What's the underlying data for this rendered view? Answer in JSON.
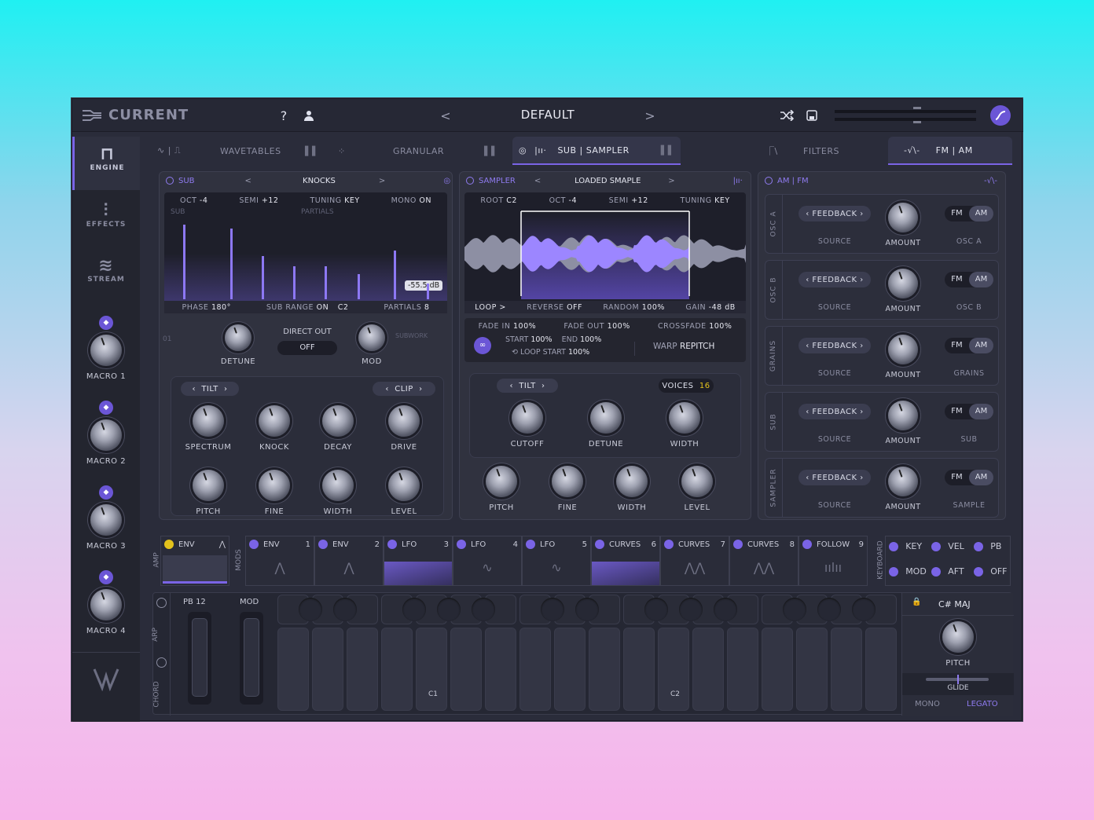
{
  "app": {
    "name": "CURRENT",
    "preset": "DEFAULT"
  },
  "sidebar": {
    "items": [
      {
        "label": "ENGINE"
      },
      {
        "label": "EFFECTS"
      },
      {
        "label": "STREAM"
      }
    ],
    "macros": [
      "MACRO 1",
      "MACRO 2",
      "MACRO 3",
      "MACRO 4"
    ]
  },
  "tabs": {
    "wavetables": "WAVETABLES",
    "granular": "GRANULAR",
    "sub_sampler": "SUB | SAMPLER",
    "filters": "FILTERS",
    "fm_am": "FM | AM"
  },
  "sub": {
    "title": "SUB",
    "preset": "KNOCKS",
    "top": {
      "oct_label": "OCT",
      "oct": "-4",
      "semi_label": "SEMI",
      "semi": "+12",
      "tuning_label": "TUNING",
      "tuning": "KEY",
      "mono_label": "MONO",
      "mono": "ON"
    },
    "viz_sub": "SUB",
    "viz_partials": "PARTIALS",
    "db": "-55.5 dB",
    "bottom": {
      "phase_label": "PHASE",
      "phase": "180°",
      "range_label": "SUB RANGE",
      "range": "ON",
      "range_note": "C2",
      "partials_label": "PARTIALS",
      "partials": "8"
    },
    "slot": "01",
    "subwork": "SUBWORK",
    "direct_out": "DIRECT OUT",
    "direct_out_val": "OFF",
    "knob_detune": "DETUNE",
    "knob_mod": "MOD",
    "tilt": "TILT",
    "clip": "CLIP",
    "row1": [
      "SPECTRUM",
      "KNOCK",
      "DECAY",
      "DRIVE"
    ],
    "row2": [
      "PITCH",
      "FINE",
      "WIDTH",
      "LEVEL"
    ],
    "partial_levels": [
      0.95,
      0.9,
      0.55,
      0.42,
      0.42,
      0.32,
      0.62,
      0.2
    ]
  },
  "sampler": {
    "title": "SAMPLER",
    "preset": "LOADED SMAPLE",
    "top": {
      "root_label": "ROOT",
      "root": "C2",
      "oct_label": "OCT",
      "oct": "-4",
      "semi_label": "SEMI",
      "semi": "+12",
      "tuning_label": "TUNING",
      "tuning": "KEY"
    },
    "bottom": {
      "loop": "LOOP >",
      "reverse_label": "REVERSE",
      "reverse": "OFF",
      "random_label": "RANDOM",
      "random": "100%",
      "gain_label": "GAIN",
      "gain": "-48 dB"
    },
    "fade_in_label": "FADE IN",
    "fade_in": "100%",
    "fade_out_label": "FADE OUT",
    "fade_out": "100%",
    "crossfade_label": "CROSSFADE",
    "crossfade": "100%",
    "start_label": "START",
    "start": "100%",
    "end_label": "END",
    "end": "100%",
    "loop_start_label": "LOOP START",
    "loop_start": "100%",
    "warp_label": "WARP",
    "warp": "REPITCH",
    "tilt": "TILT",
    "voices_label": "VOICES",
    "voices": "16",
    "row1": [
      "CUTOFF",
      "DETUNE",
      "WIDTH"
    ],
    "row2": [
      "PITCH",
      "FINE",
      "WIDTH",
      "LEVEL"
    ]
  },
  "fm": {
    "title": "AM | FM",
    "rows": [
      {
        "label": "OSC A",
        "target": "OSC A"
      },
      {
        "label": "OSC B",
        "target": "OSC B"
      },
      {
        "label": "GRAINS",
        "target": "GRAINS"
      },
      {
        "label": "SUB",
        "target": "SUB"
      },
      {
        "label": "SAMPLER",
        "target": "SAMPLE"
      }
    ],
    "feedback": "FEEDBACK",
    "source": "SOURCE",
    "amount": "AMOUNT",
    "fm": "FM",
    "am": "AM"
  },
  "mods": {
    "amp": "AMP",
    "mods_label": "MODS",
    "keyboard": "KEYBOARD",
    "slots": [
      {
        "name": "ENV",
        "num": ""
      },
      {
        "name": "ENV",
        "num": "1"
      },
      {
        "name": "ENV",
        "num": "2"
      },
      {
        "name": "LFO",
        "num": "3"
      },
      {
        "name": "LFO",
        "num": "4"
      },
      {
        "name": "LFO",
        "num": "5"
      },
      {
        "name": "CURVES",
        "num": "6"
      },
      {
        "name": "CURVES",
        "num": "7"
      },
      {
        "name": "CURVES",
        "num": "8"
      },
      {
        "name": "FOLLOW",
        "num": "9"
      }
    ],
    "kb_sources": [
      "KEY",
      "VEL",
      "PB",
      "MOD",
      "AFT",
      "OFF"
    ]
  },
  "keys": {
    "arp": "ARP",
    "chord": "CHORD",
    "pb": "PB 12",
    "mod": "MOD",
    "c1": "C1",
    "c2": "C2",
    "scale": "C# MAJ",
    "pitch": "PITCH",
    "glide": "GLIDE",
    "mono": "MONO",
    "legato": "LEGATO"
  },
  "colors": {
    "accent": "#7a64e6",
    "yellow": "#e3c21c"
  }
}
